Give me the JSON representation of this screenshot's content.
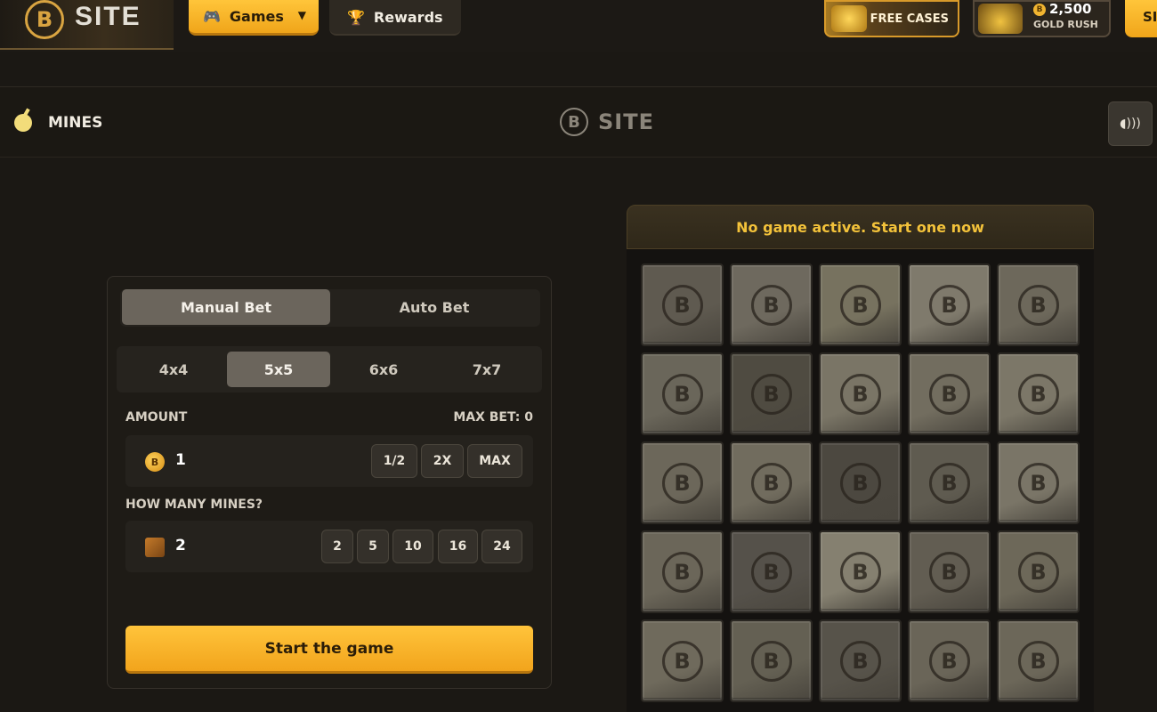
{
  "header": {
    "logo_letter": "B",
    "logo_text": "SITE",
    "nav": {
      "games_label": "Games",
      "rewards_label": "Rewards"
    },
    "promos": {
      "free_cases_label": "FREE CASES",
      "gold_rush_amount": "2,500",
      "gold_rush_label": "GOLD RUSH"
    },
    "signup_label": "SI"
  },
  "game": {
    "title": "MINES",
    "center_logo_letter": "B",
    "center_logo_text": "SITE"
  },
  "bet_panel": {
    "mode_tabs": [
      {
        "label": "Manual Bet",
        "active": true
      },
      {
        "label": "Auto Bet",
        "active": false
      }
    ],
    "grid_sizes": [
      {
        "label": "4x4",
        "active": false
      },
      {
        "label": "5x5",
        "active": true
      },
      {
        "label": "6x6",
        "active": false
      },
      {
        "label": "7x7",
        "active": false
      }
    ],
    "amount": {
      "label": "AMOUNT",
      "max_bet_label": "MAX BET: 0",
      "value": "1",
      "chips": [
        "1/2",
        "2X",
        "MAX"
      ]
    },
    "mines": {
      "label": "HOW MANY MINES?",
      "value": "2",
      "chips": [
        "2",
        "5",
        "10",
        "16",
        "24"
      ]
    },
    "start_label": "Start the game"
  },
  "board": {
    "status": "No game active. Start one now",
    "rows": 5,
    "cols": 5,
    "tile_letter": "B"
  },
  "colors": {
    "accent": "#f5b128",
    "status_text": "#f3c23a",
    "background": "#1b1814"
  }
}
